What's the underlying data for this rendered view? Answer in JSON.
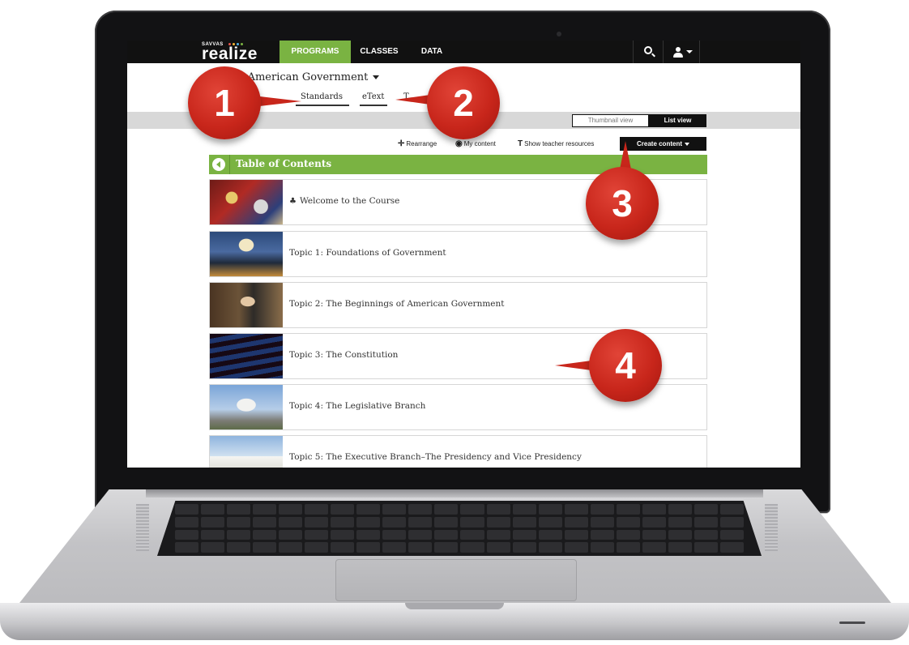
{
  "brand": {
    "logo_small": "SAVVAS",
    "logo_word": "realize",
    "logo_dot_colors": [
      "#e9534a",
      "#f7b733",
      "#4fb3e8",
      "#7ab342"
    ],
    "accent": "#7ab342"
  },
  "nav": {
    "tabs": [
      {
        "label": "PROGRAMS",
        "active": true
      },
      {
        "label": "CLASSES",
        "active": false
      },
      {
        "label": "DATA",
        "active": false
      }
    ],
    "search_icon": "search-icon",
    "user_icon": "user-icon"
  },
  "program": {
    "title": "r's American Government",
    "subtabs": [
      {
        "label": "Standards"
      },
      {
        "label": "eText"
      },
      {
        "label": "T"
      }
    ]
  },
  "view_toggle": {
    "thumbnail": "Thumbnail view",
    "list": "List view",
    "selected": "List view"
  },
  "toolbar": {
    "rearrange": "Rearrange",
    "my_content": "My content",
    "teacher_resources": "Show teacher resources",
    "create_content": "Create content"
  },
  "toc": {
    "title": "Table of Contents",
    "items": [
      {
        "label": "Welcome to the Course",
        "icon": "tree-icon"
      },
      {
        "label": "Topic 1: Foundations of Government"
      },
      {
        "label": "Topic 2: The Beginnings of American Government"
      },
      {
        "label": "Topic 3: The Constitution"
      },
      {
        "label": "Topic 4: The Legislative Branch"
      },
      {
        "label": "Topic 5: The Executive Branch–The Presidency and Vice Presidency"
      }
    ]
  },
  "callouts": [
    "1",
    "2",
    "3",
    "4"
  ]
}
